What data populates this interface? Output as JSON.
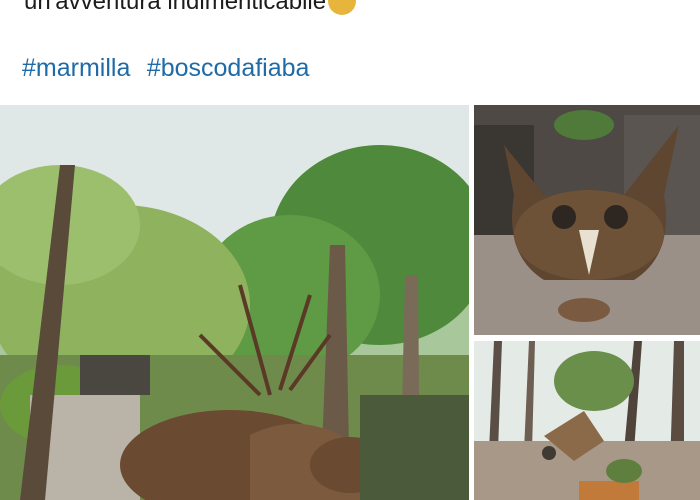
{
  "post": {
    "text": "un'avventura indimenticabile",
    "emoji_icon": "face-emoji-icon",
    "hashtags": [
      "#marmilla",
      "#boscodafiaba"
    ]
  },
  "gallery": {
    "photos": [
      {
        "subject": "deer-sculpture-photo"
      },
      {
        "subject": "owl-sculpture-photo"
      },
      {
        "subject": "forest-sculpture-photo"
      }
    ]
  },
  "colors": {
    "hashtag": "#1f6ba8",
    "text": "#1c1c1c",
    "emoji": "#e8b53c"
  }
}
